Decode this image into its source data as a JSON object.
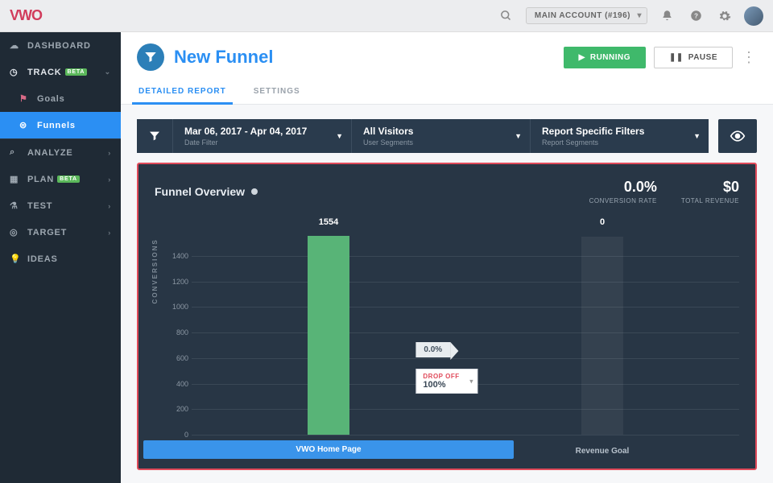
{
  "topbar": {
    "account_label": "MAIN ACCOUNT (#196)"
  },
  "sidebar": {
    "items": [
      {
        "label": "DASHBOARD"
      },
      {
        "label": "TRACK",
        "beta": "BETA"
      },
      {
        "label": "Goals"
      },
      {
        "label": "Funnels"
      },
      {
        "label": "ANALYZE"
      },
      {
        "label": "PLAN",
        "beta": "BETA"
      },
      {
        "label": "TEST"
      },
      {
        "label": "TARGET"
      },
      {
        "label": "IDEAS"
      }
    ]
  },
  "page": {
    "title": "New Funnel",
    "running_label": "RUNNING",
    "pause_label": "PAUSE",
    "tabs": {
      "detailed": "DETAILED REPORT",
      "settings": "SETTINGS"
    }
  },
  "filters": {
    "date": {
      "title": "Mar 06, 2017 - Apr 04, 2017",
      "sub": "Date Filter"
    },
    "segments": {
      "title": "All Visitors",
      "sub": "User Segments"
    },
    "report": {
      "title": "Report Specific Filters",
      "sub": "Report Segments"
    }
  },
  "overview": {
    "title": "Funnel Overview",
    "conversion_rate": {
      "value": "0.0%",
      "label": "CONVERSION RATE"
    },
    "total_revenue": {
      "value": "$0",
      "label": "TOTAL REVENUE"
    }
  },
  "chart_data": {
    "type": "bar",
    "ylabel": "CONVERSIONS",
    "ylim": [
      0,
      1600
    ],
    "yticks": [
      0,
      200,
      400,
      600,
      800,
      1000,
      1200,
      1400
    ],
    "categories": [
      "VWO Home Page",
      "Revenue Goal"
    ],
    "values": [
      1554,
      0
    ],
    "transition": {
      "percent": "0.0%",
      "dropoff_label": "DROP OFF",
      "dropoff_value": "100%"
    }
  }
}
